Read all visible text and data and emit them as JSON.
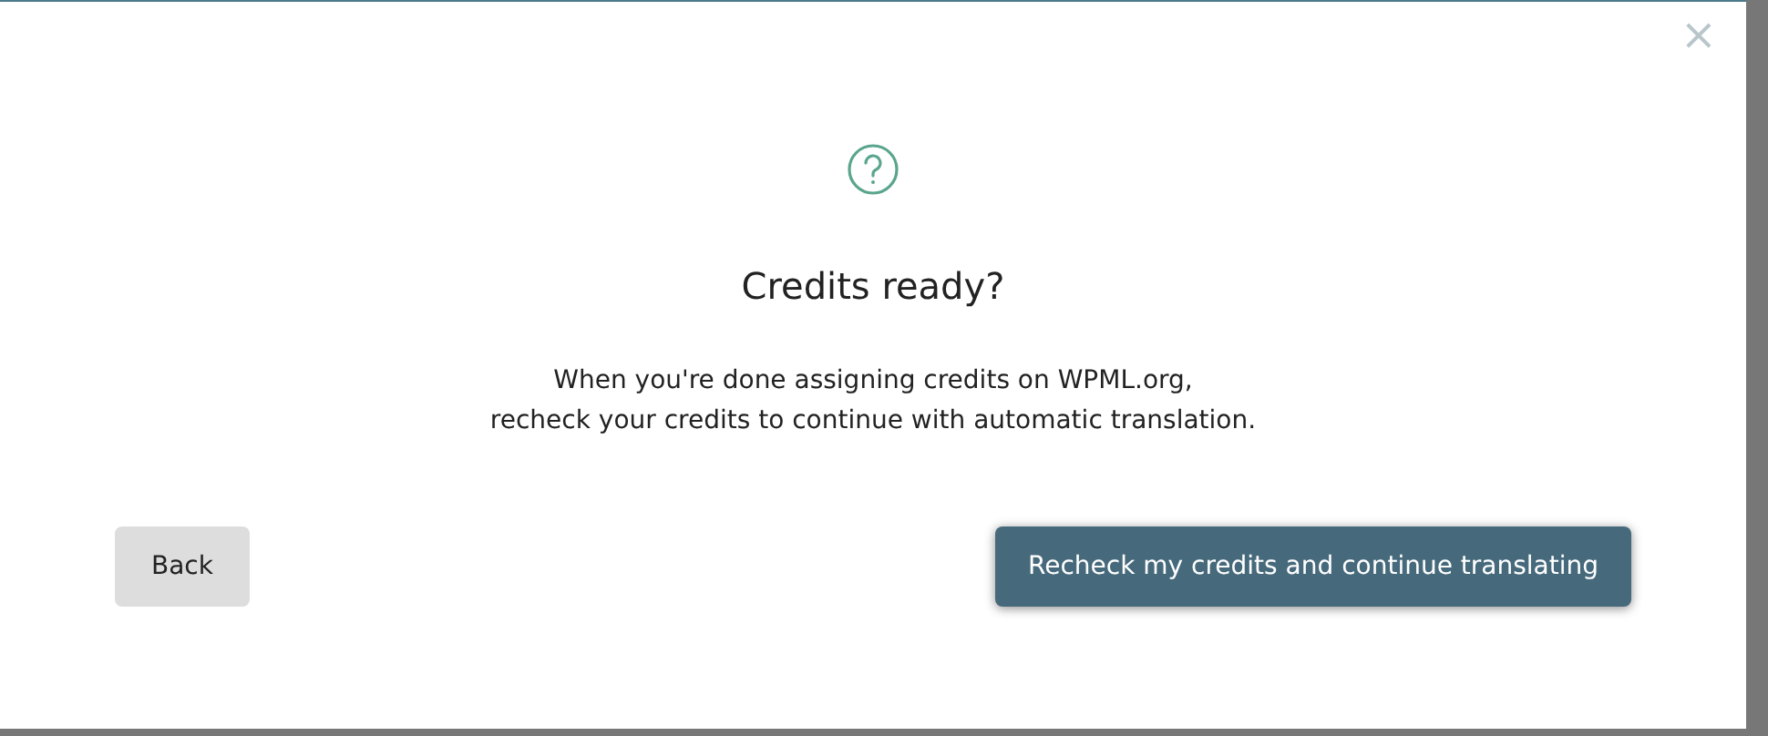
{
  "dialog": {
    "close": "×",
    "title": "Credits ready?",
    "message_lines": [
      "When you're done assigning credits on WPML.org,",
      "recheck your credits to continue with automatic translation."
    ],
    "buttons": [
      {
        "label": "Back",
        "kind": "secondary"
      },
      {
        "label": "Recheck my credits and continue translating",
        "kind": "primary"
      }
    ]
  }
}
